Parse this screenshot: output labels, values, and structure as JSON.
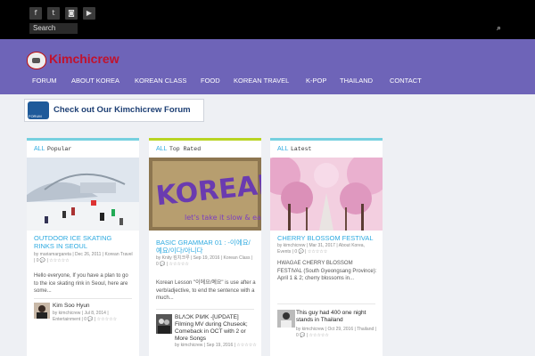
{
  "colors": {
    "topbar": "#000000",
    "header": "#6e64b8",
    "logo": "#c1122d",
    "accent": "#2eaae0",
    "popular_bar": "#76d0df",
    "toprated_bar": "#b8d422",
    "latest_bar": "#76d0df"
  },
  "topbar": {
    "social_icons": [
      "facebook-icon",
      "twitter-icon",
      "instagram-icon",
      "youtube-icon"
    ],
    "social_glyphs": [
      "f",
      "t",
      "◙",
      "▶"
    ],
    "search_placeholder": "Search"
  },
  "header": {
    "logo_text": "Kimchicrew",
    "nav": [
      "FORUM",
      "ABOUT KOREA",
      "KOREAN CLASS",
      "FOOD",
      "KOREAN TRAVEL",
      "K-POP",
      "THAILAND",
      "CONTACT"
    ]
  },
  "banner": {
    "text": "Check out Our Kimchicrew Forum"
  },
  "columns": [
    {
      "all": "ALL",
      "label": "Popular",
      "post": {
        "title": "OUTDOOR ICE SKATING RINKS IN SEOUL",
        "meta": "by mariamargareta | Dec 26, 2011 | Korean Travel | 0 💬 | ☆☆☆☆☆",
        "excerpt": "Hello everyone, If you have a plan to go to the ice skating rink in Seoul, here are some..."
      },
      "small": {
        "title": "Kim Soo Hyun",
        "meta": "by kimchicrew | Jul 8, 2014 | Entertainment | 0 💬 | ☆☆☆☆☆"
      }
    },
    {
      "all": "ALL",
      "label": "Top Rated",
      "image_text": [
        "KOREAN",
        "let's take it slow & easy!"
      ],
      "post": {
        "title": "BASIC GRAMMAR 01 : -이에요/예요/이다/아니다",
        "meta": "by Knity 킴치크루 | Sep 19, 2016 | Korean Class | 0 💬 | ☆☆☆☆☆",
        "excerpt": "Korean Lesson \"이에요/예요\" is use after a verb/adjective, to end the sentence with a much..."
      },
      "small": {
        "title": "BLΛƆK PIИK -[UPDATE] Filming MV during Chuseok; Comeback in OCT with 2 or More Songs",
        "meta": "by kimchicrew | Sep 19, 2016 | ☆☆☆☆☆"
      }
    },
    {
      "all": "ALL",
      "label": "Latest",
      "post": {
        "title": "CHERRY BLOSSOM FESTIVAL",
        "meta": "by kimchicrew | Mar 31, 2017 | About Korea, Events | 0 💬 | ☆☆☆☆☆",
        "excerpt": "HWAGAE CHERRY BLOSSOM FESTIVAL (South Gyeongsang Province): April 1 & 2; cherry blossoms in..."
      },
      "small": {
        "title": "This guy had 400 one night stands in Thailand",
        "meta": "by kimchicrew | Oct 29, 2016 | Thailand | 0 💬 | ☆☆☆☆☆"
      }
    }
  ]
}
